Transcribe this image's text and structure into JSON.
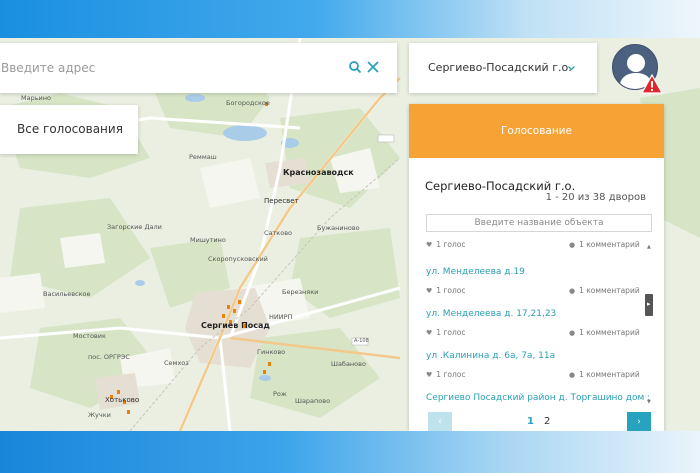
{
  "search": {
    "placeholder": "Введите адрес"
  },
  "district": {
    "selected": "Сергиево-Посадский г.о."
  },
  "all_votes_label": "Все голосования",
  "panel": {
    "header": "Голосование",
    "title": "Сергиево-Посадский г.о.",
    "count": "1 - 20 из 38 дворов",
    "object_search_placeholder": "Введите название объекта",
    "items": [
      {
        "name": "",
        "votes": "1 голос",
        "comments": "1 комментарий"
      },
      {
        "name": "ул. Менделеева д.19",
        "votes": "1 голос",
        "comments": "1 комментарий"
      },
      {
        "name": "ул. Менделеева д. 17,21,23",
        "votes": "1 голос",
        "comments": "1 комментарий"
      },
      {
        "name": "ул .Калинина д. 6а, 7а, 11а",
        "votes": "1 голос",
        "comments": "1 комментарий"
      },
      {
        "name": "Сергиево Посадский район д. Торгашино дом : №",
        "votes": "",
        "comments": ""
      }
    ],
    "pager": {
      "prev": "‹",
      "next": "›",
      "pages": [
        "1",
        "2"
      ],
      "current": "1"
    }
  },
  "map_labels": {
    "marino": "Марьино",
    "bogorodskoe": "Богородское",
    "krasnozavodsk": "Краснозаводск",
    "peresvet": "Пересвет",
    "zagorskie_dali": "Загорские Дали",
    "mishutino": "Мишутино",
    "skoropusk": "Скоропусковский",
    "buzhaninovo": "Бужаниново",
    "vasilevskoe": "Васильевское",
    "sergiev_posad": "Сергиев Посад",
    "mostovik": "Мостовик",
    "semhoz": "Семхоз",
    "khotkovo": "Хотьково",
    "zhuchki": "Жучки",
    "sharapovo": "Шарапово",
    "bereznyaki": "Березняки",
    "remmash": "Реммаш",
    "shabanovo": "Шабаново",
    "niipp": "НИИРП",
    "rozh": "Рож",
    "ginkovo": "Гинково",
    "sadivo": "Сатково",
    "orrt": "пос. ОРГРЭС",
    "road_a108": "А-108"
  },
  "colors": {
    "header_orange": "#f7a235",
    "link_teal": "#2a9fb5",
    "pager_active": "#27a3c0",
    "warning_red": "#e0262b"
  }
}
